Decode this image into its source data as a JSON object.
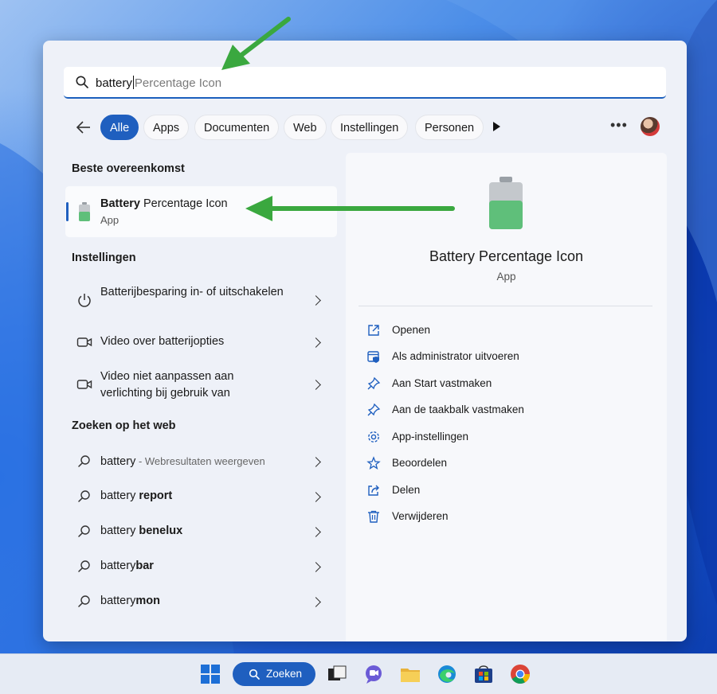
{
  "search": {
    "typed": "battery",
    "suggestion": "Percentage Icon"
  },
  "filters": {
    "chips": [
      "Alle",
      "Apps",
      "Documenten",
      "Web",
      "Instellingen",
      "Personen"
    ],
    "active": "Alle"
  },
  "left": {
    "best_match_title": "Beste overeenkomst",
    "best_match": {
      "name_bold": "Battery",
      "name_rest": " Percentage Icon",
      "type": "App"
    },
    "settings_title": "Instellingen",
    "settings": [
      {
        "label": "Batterijbesparing in- of uitschakelen",
        "icon": "power-icon"
      },
      {
        "label": "Video over batterijopties",
        "icon": "video-icon"
      },
      {
        "label": "Video niet aanpassen aan verlichting bij gebruik van",
        "icon": "video-icon"
      }
    ],
    "web_title": "Zoeken op het web",
    "web": [
      {
        "plain": "battery",
        "bold": "",
        "extra": " - Webresultaten weergeven"
      },
      {
        "plain": "battery ",
        "bold": "report",
        "extra": ""
      },
      {
        "plain": "battery ",
        "bold": "benelux",
        "extra": ""
      },
      {
        "plain": "battery",
        "bold": "bar",
        "extra": ""
      },
      {
        "plain": "battery",
        "bold": "mon",
        "extra": ""
      }
    ]
  },
  "right": {
    "app_name": "Battery Percentage Icon",
    "app_type": "App",
    "actions": [
      {
        "label": "Openen",
        "icon": "open-external-icon"
      },
      {
        "label": "Als administrator uitvoeren",
        "icon": "admin-shield-icon"
      },
      {
        "label": "Aan Start vastmaken",
        "icon": "pin-icon"
      },
      {
        "label": "Aan de taakbalk vastmaken",
        "icon": "pin-icon"
      },
      {
        "label": "App-instellingen",
        "icon": "gear-icon"
      },
      {
        "label": "Beoordelen",
        "icon": "star-icon"
      },
      {
        "label": "Delen",
        "icon": "share-icon"
      },
      {
        "label": "Verwijderen",
        "icon": "trash-icon"
      }
    ]
  },
  "taskbar": {
    "search_label": "Zoeken"
  },
  "colors": {
    "accent": "#1f5fbf",
    "battery_green": "#5fbf7a",
    "annotation_arrow": "#3aa83f"
  }
}
